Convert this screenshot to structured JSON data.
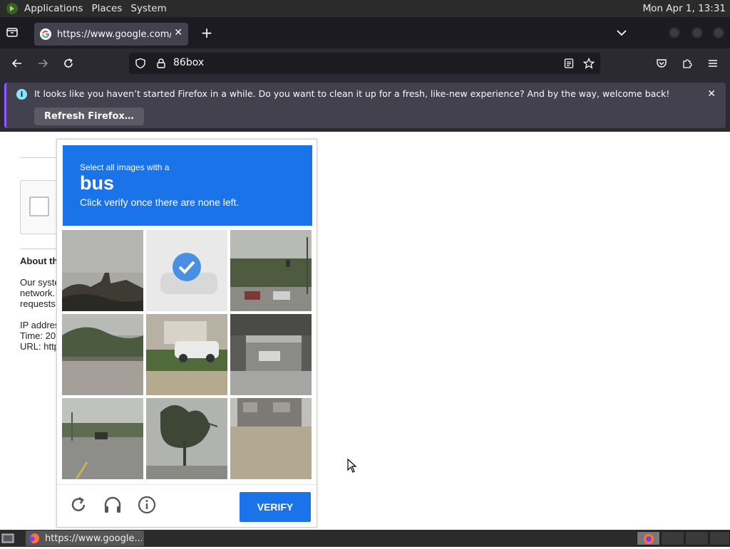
{
  "top_panel": {
    "menu": [
      "Applications",
      "Places",
      "System"
    ],
    "clock": "Mon Apr  1, 13:31"
  },
  "browser": {
    "tab_title": "https://www.google.com/sorry/index",
    "url": "86box",
    "notification": {
      "message": "It looks like you haven’t started Firefox in a while. Do you want to clean it up for a fresh, like-new experience? And by the way, welcome back!",
      "button": "Refresh Firefox…"
    }
  },
  "page": {
    "about_heading": "About th",
    "para": [
      "Our syste",
      "network.",
      "requests"
    ],
    "info": [
      "IP addres",
      "Time: 20",
      "URL: http"
    ]
  },
  "captcha": {
    "instruction": "Select all images with a",
    "target": "bus",
    "subtext": "Click verify once there are none left.",
    "verify_label": "VERIFY",
    "selected_tiles": [
      2
    ],
    "accent_color": "#1a73e8"
  },
  "taskbar": {
    "window_label": "https://www.google..."
  }
}
